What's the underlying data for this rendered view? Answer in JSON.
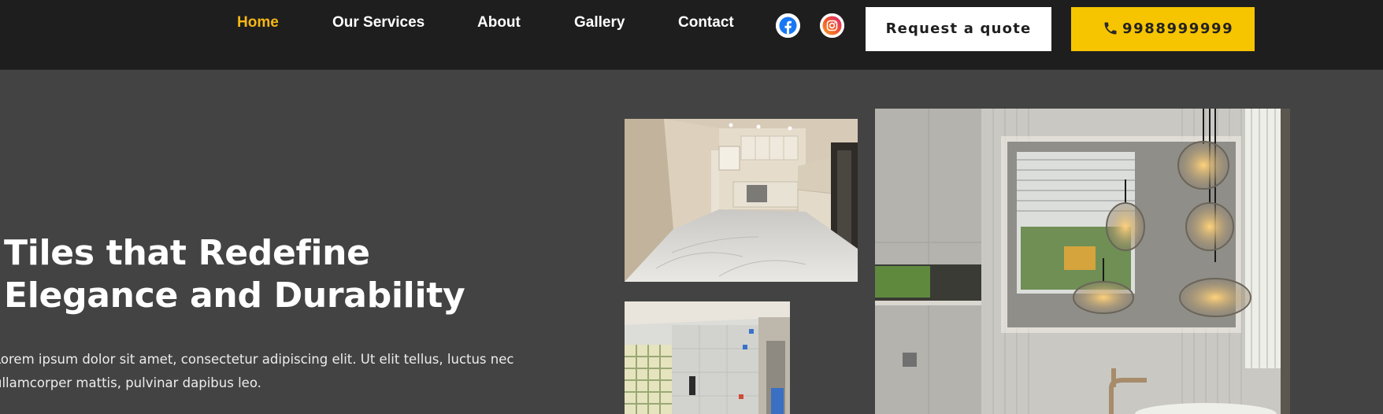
{
  "nav": {
    "items": [
      {
        "label": "Home",
        "active": true
      },
      {
        "label": "Our Services",
        "active": false
      },
      {
        "label": "About",
        "active": false
      },
      {
        "label": "Gallery",
        "active": false
      },
      {
        "label": "Contact",
        "active": false
      }
    ],
    "active_color": "#f5b716"
  },
  "social": {
    "facebook_icon": "facebook-icon",
    "instagram_icon": "instagram-icon"
  },
  "cta": {
    "quote_label": "Request a quote",
    "phone_number": "9988999999",
    "phone_icon": "phone-icon",
    "phone_bg": "#f7c400"
  },
  "hero": {
    "title_line1": "Tiles that Redefine",
    "title_line2": "Elegance and Durability",
    "body_line1": "Lorem ipsum dolor sit amet, consectetur adipiscing elit. Ut elit tellus, luctus nec",
    "body_line2": "ullamcorper mattis, pulvinar dapibus leo."
  },
  "gallery": {
    "images": [
      "kitchen-photo",
      "bathroom-photo",
      "bathroom-mirror-photo"
    ]
  }
}
